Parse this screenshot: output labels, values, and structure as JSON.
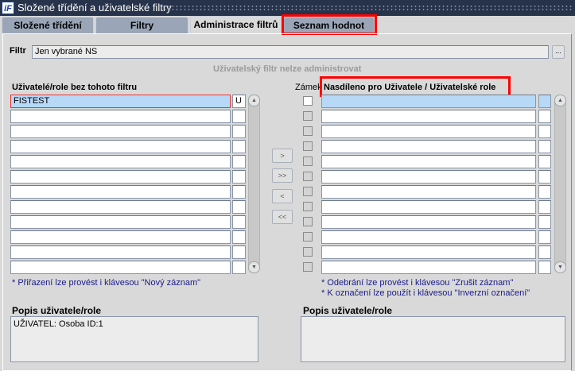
{
  "window": {
    "title": "Složené třídění a uživatelské filtry",
    "logo": "iF"
  },
  "tabs": [
    {
      "label": "Složené třídění"
    },
    {
      "label": "Filtry"
    },
    {
      "label": "Administrace filtrů"
    },
    {
      "label": "Seznam hodnot"
    }
  ],
  "filter": {
    "label": "Filtr",
    "value": "Jen vybrané NS",
    "button": "...",
    "info": "Uživatelský filtr nelze administrovat"
  },
  "left": {
    "header": "Uživatelé/role bez tohoto filtru",
    "rows": [
      {
        "name": "FISTEST",
        "type": "U"
      },
      {
        "name": "",
        "type": ""
      },
      {
        "name": "",
        "type": ""
      },
      {
        "name": "",
        "type": ""
      },
      {
        "name": "",
        "type": ""
      },
      {
        "name": "",
        "type": ""
      },
      {
        "name": "",
        "type": ""
      },
      {
        "name": "",
        "type": ""
      },
      {
        "name": "",
        "type": ""
      },
      {
        "name": "",
        "type": ""
      },
      {
        "name": "",
        "type": ""
      },
      {
        "name": "",
        "type": ""
      }
    ],
    "note": "* Přiřazení lze provést i klávesou \"Nový záznam\""
  },
  "move_buttons": {
    "add": ">",
    "add_all": ">>",
    "remove": "<",
    "remove_all": "<<"
  },
  "right": {
    "lock_header": "Zámek",
    "header": "Nasdíleno pro Uživatele / Uživatelské role",
    "rows": 12,
    "note1": "* Odebrání lze provést i klávesou \"Zrušit záznam\"",
    "note2": "* K označení lze použít i klávesou \"Inverzní označení\""
  },
  "desc_left": {
    "label": "Popis uživatele/role",
    "value": "UŽIVATEL: Osoba ID:1"
  },
  "desc_right": {
    "label": "Popis uživatele/role",
    "value": ""
  },
  "colors": {
    "highlight": "#ff0000",
    "selected": "#b8d8f8"
  }
}
